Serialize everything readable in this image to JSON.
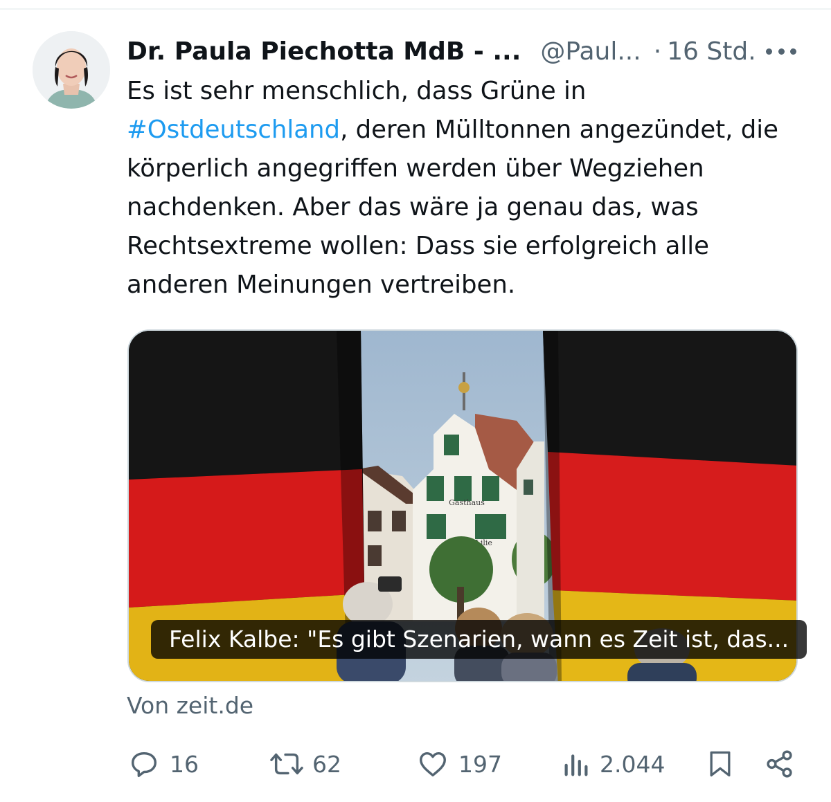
{
  "tweet": {
    "author_name": "Dr. Paula Piechotta MdB - ...",
    "handle": "@Paul...",
    "separator": "·",
    "time": "16 Std.",
    "text": {
      "part1": "Es ist sehr menschlich, dass Grüne in",
      "hashtag": "#Ostdeutschland",
      "part2": ", deren Mülltonnen angezündet, die körperlich angegriffen werden über Wegziehen nachdenken. Aber das wäre ja genau das, was Rechtsextreme wollen: Dass sie erfolgreich alle anderen Meinungen vertreiben."
    },
    "card": {
      "caption": "Felix Kalbe: \"Es gibt Szenarien, wann es Zeit ist, das...",
      "source": "Von zeit.de",
      "image_sign_text": "Gasthaus",
      "image_sign_text2": "Zur ... Lilie"
    },
    "actions": {
      "replies": "16",
      "retweets": "62",
      "likes": "197",
      "views": "2.044"
    }
  },
  "colors": {
    "text": "#0f1419",
    "secondary": "#536471",
    "link": "#1d9bf0",
    "border": "#cfd9de"
  },
  "icons": [
    "more-icon",
    "reply-icon",
    "retweet-icon",
    "like-icon",
    "views-icon",
    "bookmark-icon",
    "share-icon"
  ]
}
